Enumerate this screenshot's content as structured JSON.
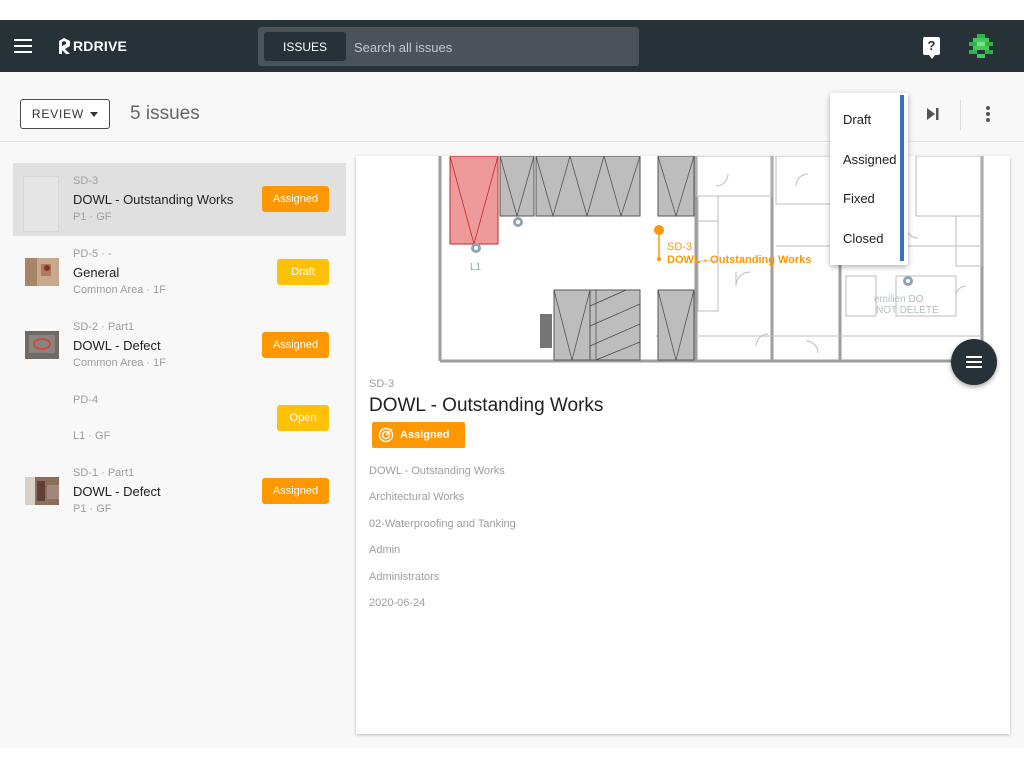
{
  "header": {
    "logo_text": "RDRIVE",
    "search_chip_label": "ISSUES",
    "search_placeholder": "Search all issues",
    "help_icon": "?",
    "colors": {
      "bar": "#263238",
      "accent": "#ff9800"
    }
  },
  "toolbar": {
    "review_label": "REVIEW",
    "issue_count": "5 issues"
  },
  "status_menu": {
    "options": [
      "Draft",
      "Assigned",
      "Fixed",
      "Closed"
    ]
  },
  "issues": [
    {
      "code": "SD-3",
      "title": "DOWL - Outstanding Works",
      "location": "P1 · GF",
      "status": "Assigned"
    },
    {
      "code": "PD-5 · -",
      "title": "General",
      "location": "Common Area · 1F",
      "status": "Draft"
    },
    {
      "code": "SD-2 · Part1",
      "title": "DOWL - Defect",
      "location": "Common Area · 1F",
      "status": "Assigned"
    },
    {
      "code": "PD-4",
      "title": "",
      "location": "L1 · GF",
      "status": "Open"
    },
    {
      "code": "SD-1 · Part1",
      "title": "DOWL - Defect",
      "location": "P1 · GF",
      "status": "Assigned"
    }
  ],
  "detail": {
    "code": "SD-3",
    "title": "DOWL - Outstanding Works",
    "status": "Assigned",
    "fields": [
      "DOWL - Outstanding Works",
      "Architectural Works",
      "02-Waterproofing and Tanking",
      "Admin",
      "Administrators",
      "2020-06-24"
    ],
    "plan_labels": {
      "pin_code": "SD-3",
      "pin_title": "DOWL - Outstanding Works",
      "marker_l1": "L1",
      "ghost_text_1": "emilien DO",
      "ghost_text_2": "NOT DELETE"
    }
  }
}
